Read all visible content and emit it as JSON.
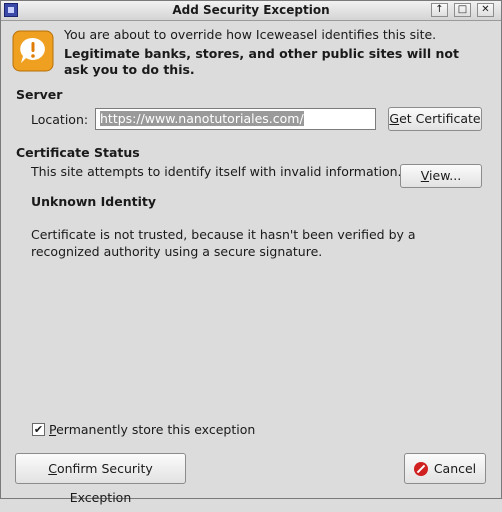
{
  "window": {
    "title": "Add Security Exception",
    "controls": [
      "↑",
      "□",
      "✕"
    ]
  },
  "message": {
    "line1": "You are about to override how Iceweasel identifies this site.",
    "line2": "Legitimate banks, stores, and other public sites will not ask you to do this."
  },
  "server": {
    "heading": "Server",
    "location_label": "Location:",
    "location_value": "https://www.nanotutoriales.com/",
    "get_certificate_label": "Get Certificate",
    "get_certificate_accel": "G",
    "get_certificate_rest": "et Certificate"
  },
  "certificate_status": {
    "heading": "Certificate Status",
    "text": "This site attempts to identify itself with invalid information.",
    "view_label": "View...",
    "view_accel": "V",
    "view_rest": "iew...",
    "identity_heading": "Unknown Identity",
    "identity_text": "Certificate is not trusted, because it hasn't been verified by a recognized authority using a secure signature."
  },
  "footer": {
    "permanent_label": "Permanently store this exception",
    "permanent_accel": "P",
    "permanent_rest": "ermanently store this exception",
    "permanent_checked": true,
    "confirm_label": "Confirm Security Exception",
    "confirm_accel": "C",
    "confirm_rest": "onfirm Security Exception",
    "cancel_label": "Cancel"
  },
  "colors": {
    "warning_icon": "#f0a020",
    "cancel_icon": "#d02020",
    "selection": "#9a9a9a"
  }
}
